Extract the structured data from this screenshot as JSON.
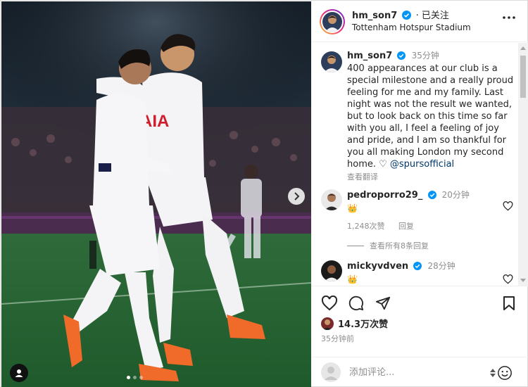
{
  "post": {
    "username": "hm_son7",
    "following_label": "· 已关注",
    "location": "Tottenham Hotspur Stadium"
  },
  "caption": {
    "username": "hm_son7",
    "time": "35分钟",
    "text": "400 appearances at our club is a special milestone and a really proud feeling for me and my family. Last night was not the result we wanted, but to look back on this time so far with you all, I feel a feeling of joy and pride, and I am so thankful for you all making London my second home. ♡ ",
    "mention": "@spursofficial",
    "translate_label": "查看翻译"
  },
  "comments": [
    {
      "username": "pedroporro29_",
      "time": "20分钟",
      "emoji": "👑",
      "likes": "1,248次赞",
      "reply_label": "回复",
      "view_replies": "查看所有8条回复"
    },
    {
      "username": "mickyvdven",
      "time": "28分钟",
      "emoji": "👑"
    }
  ],
  "engagement": {
    "likes": "14.3万次赞",
    "posted_ago": "35分钟前"
  },
  "composer": {
    "placeholder": "添加评论..."
  },
  "colors": {
    "verified": "#0095f6",
    "link": "#00376b",
    "muted": "#8e8e8e"
  },
  "icons": {
    "verified": "verified-badge-icon",
    "more": "more-horizontal-icon",
    "like": "heart-icon",
    "comment": "comment-icon",
    "share": "paper-plane-icon",
    "save": "bookmark-icon",
    "emoji": "smiley-icon",
    "tag": "user-tag-icon",
    "next": "chevron-right-icon"
  },
  "carousel": {
    "slides": 3,
    "current": 1
  }
}
